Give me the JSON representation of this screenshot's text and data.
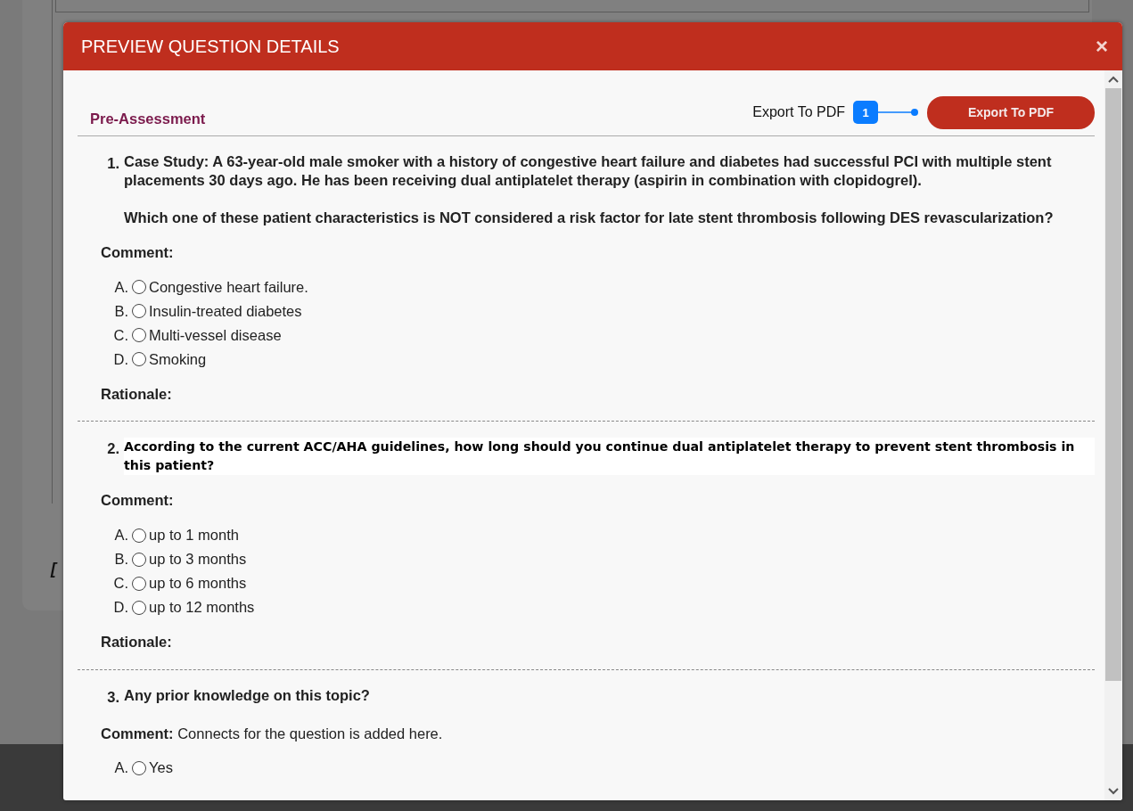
{
  "background": {
    "text": "["
  },
  "modal": {
    "title": "PREVIEW QUESTION DETAILS",
    "close": "×"
  },
  "section": {
    "title": "Pre-Assessment"
  },
  "export": {
    "label": "Export To PDF",
    "badge": "1",
    "button": "Export To PDF"
  },
  "questions": [
    {
      "number": "1.",
      "kind": "normal",
      "paragraphs": [
        "Case Study: A 63-year-old male smoker with a history of congestive heart failure and diabetes had successful PCI with multiple stent placements 30 days ago. He has been receiving dual antiplatelet therapy (aspirin in combination with clopidogrel).",
        "Which one of these patient characteristics is NOT considered a risk factor for late stent thrombosis following DES revascularization?"
      ],
      "comment_label": "Comment:",
      "options": [
        {
          "letter": "A.",
          "text": "Congestive heart failure.",
          "selected": false
        },
        {
          "letter": "B.",
          "text": "Insulin-treated diabetes",
          "selected": false
        },
        {
          "letter": "C.",
          "text": "Multi-vessel disease",
          "selected": false
        },
        {
          "letter": "D.",
          "text": "Smoking",
          "selected": false
        }
      ],
      "rationale_label": "Rationale:"
    },
    {
      "number": "2.",
      "kind": "pasted",
      "paragraphs": [
        "According to the current ACC/AHA guidelines, how long should you continue dual antiplatelet therapy to prevent stent thrombosis in this patient?"
      ],
      "comment_label": "Comment:",
      "options": [
        {
          "letter": "A.",
          "text": "up to 1 month",
          "selected": false
        },
        {
          "letter": "B.",
          "text": "up to 3 months",
          "selected": false
        },
        {
          "letter": "C.",
          "text": "up to 6 months",
          "selected": false
        },
        {
          "letter": "D.",
          "text": "up to 12 months",
          "selected": false
        }
      ],
      "rationale_label": "Rationale:"
    },
    {
      "number": "3.",
      "kind": "normal",
      "paragraphs": [
        "Any prior knowledge on this topic?"
      ],
      "comment_label": "Comment:",
      "comment": "Connects for the question is added here.",
      "options": [
        {
          "letter": "A.",
          "text": "Yes",
          "selected": false
        }
      ]
    }
  ]
}
